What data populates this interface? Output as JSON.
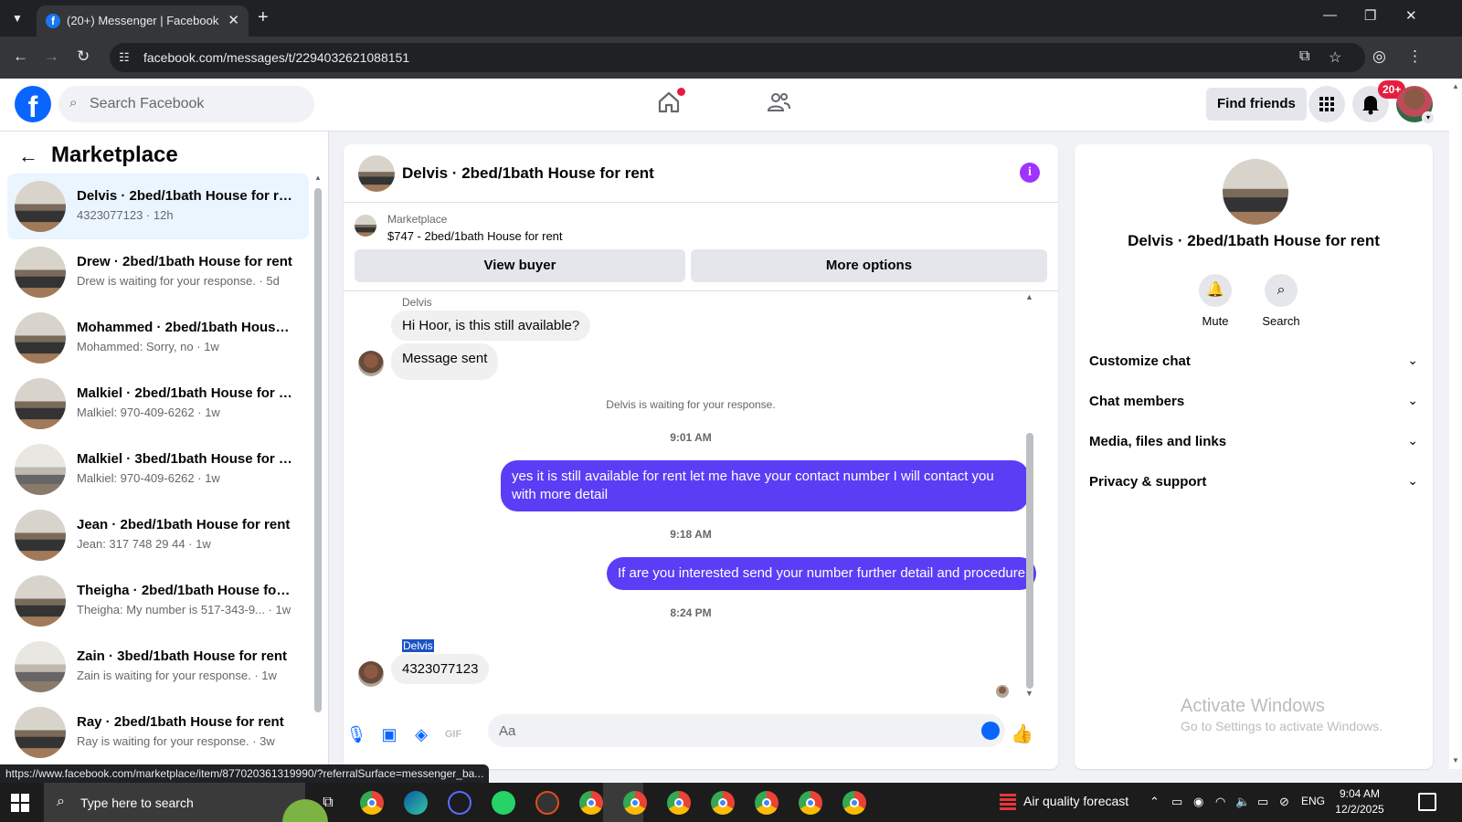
{
  "browser": {
    "tab_title": "(20+) Messenger | Facebook",
    "url": "facebook.com/messages/t/2294032621088151",
    "new_tab_symbol": "+",
    "close_symbol": "✕",
    "status_url": "https://www.facebook.com/marketplace/item/877020361319990/?referralSurface=messenger_ba..."
  },
  "fb_header": {
    "search_placeholder": "Search Facebook",
    "find_friends_label": "Find friends",
    "notification_badge": "20+"
  },
  "left_panel": {
    "title": "Marketplace",
    "conversations": [
      {
        "name": "Delvis · 2bed/1bath House for rent",
        "snippet": "4323077123 · 12h",
        "active": true
      },
      {
        "name": "Drew · 2bed/1bath House for rent",
        "snippet": "Drew is waiting for your response. · 5d"
      },
      {
        "name": "Mohammed · 2bed/1bath House...",
        "snippet": "Mohammed: Sorry, no · 1w"
      },
      {
        "name": "Malkiel · 2bed/1bath House for r...",
        "snippet": "Malkiel: 970-409-6262 · 1w"
      },
      {
        "name": "Malkiel · 3bed/1bath House for r...",
        "snippet": "Malkiel: 970-409-6262 · 1w"
      },
      {
        "name": "Jean · 2bed/1bath House for rent",
        "snippet": "Jean: 317 748 29 44 · 1w"
      },
      {
        "name": "Theigha · 2bed/1bath House for ...",
        "snippet": "Theigha: My number is 517-343-9... · 1w"
      },
      {
        "name": "Zain · 3bed/1bath House for rent",
        "snippet": "Zain is waiting for your response. · 1w"
      },
      {
        "name": "Ray · 2bed/1bath House for rent",
        "snippet": "Ray is waiting for your response. · 3w"
      }
    ]
  },
  "chat": {
    "title": "Delvis · 2bed/1bath House for rent",
    "marketplace_label": "Marketplace",
    "listing": "$747 - 2bed/1bath House for rent",
    "view_buyer_label": "View buyer",
    "more_options_label": "More options",
    "messages": {
      "sender_1": "Delvis",
      "in_1": "Hi Hoor, is this still available?",
      "in_2": "Message sent",
      "system_1": "Delvis is waiting for your response.",
      "time_1": "9:01 AM",
      "out_1": "yes it is still available for rent let me have your contact number I will contact you with more detail",
      "time_2": "9:18 AM",
      "out_2": "If are you interested send your number further detail and procedure",
      "time_3": "8:24 PM",
      "sender_2": "Delvis",
      "in_3": "4323077123"
    },
    "composer_placeholder": "Aa"
  },
  "right_panel": {
    "name": "Delvis · 2bed/1bath House for rent",
    "mute_label": "Mute",
    "search_label": "Search",
    "sections": [
      "Customize chat",
      "Chat members",
      "Media, files and links",
      "Privacy & support"
    ],
    "activate_line1": "Activate Windows",
    "activate_line2": "Go to Settings to activate Windows."
  },
  "taskbar": {
    "search_text": "Type here to search",
    "weather": "Air quality forecast",
    "lang": "ENG",
    "time": "9:04 AM",
    "date": "12/2/2025"
  }
}
